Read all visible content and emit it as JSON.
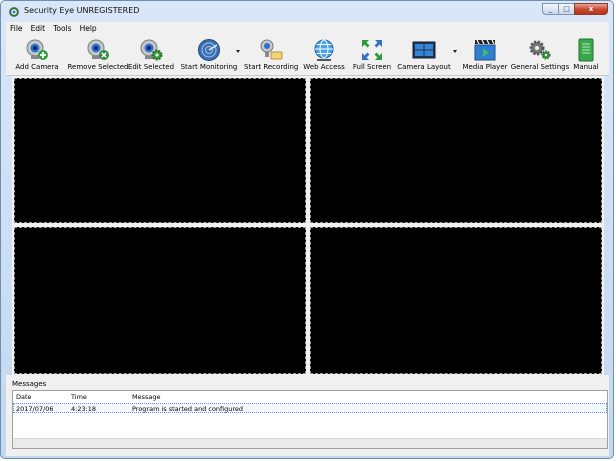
{
  "window": {
    "title": "Security Eye UNREGISTERED",
    "minimize": "_",
    "maximize": "□",
    "close": "x"
  },
  "menu": [
    "File",
    "Edit",
    "Tools",
    "Help"
  ],
  "toolbar": {
    "add_camera": "Add Camera",
    "remove_selected": "Remove Selected",
    "edit_selected": "Edit Selected",
    "start_monitoring": "Start Monitoring",
    "start_recording": "Start Recording",
    "web_access": "Web Access",
    "full_screen": "Full Screen",
    "camera_layout": "Camera Layout",
    "media_player": "Media Player",
    "general_settings": "General Settings",
    "manual": "Manual"
  },
  "messages": {
    "title": "Messages",
    "columns": [
      "Date",
      "Time",
      "Message"
    ],
    "rows": [
      {
        "date": "2017/07/06",
        "time": "4:23:18",
        "message": "Program is started and configured"
      }
    ]
  }
}
